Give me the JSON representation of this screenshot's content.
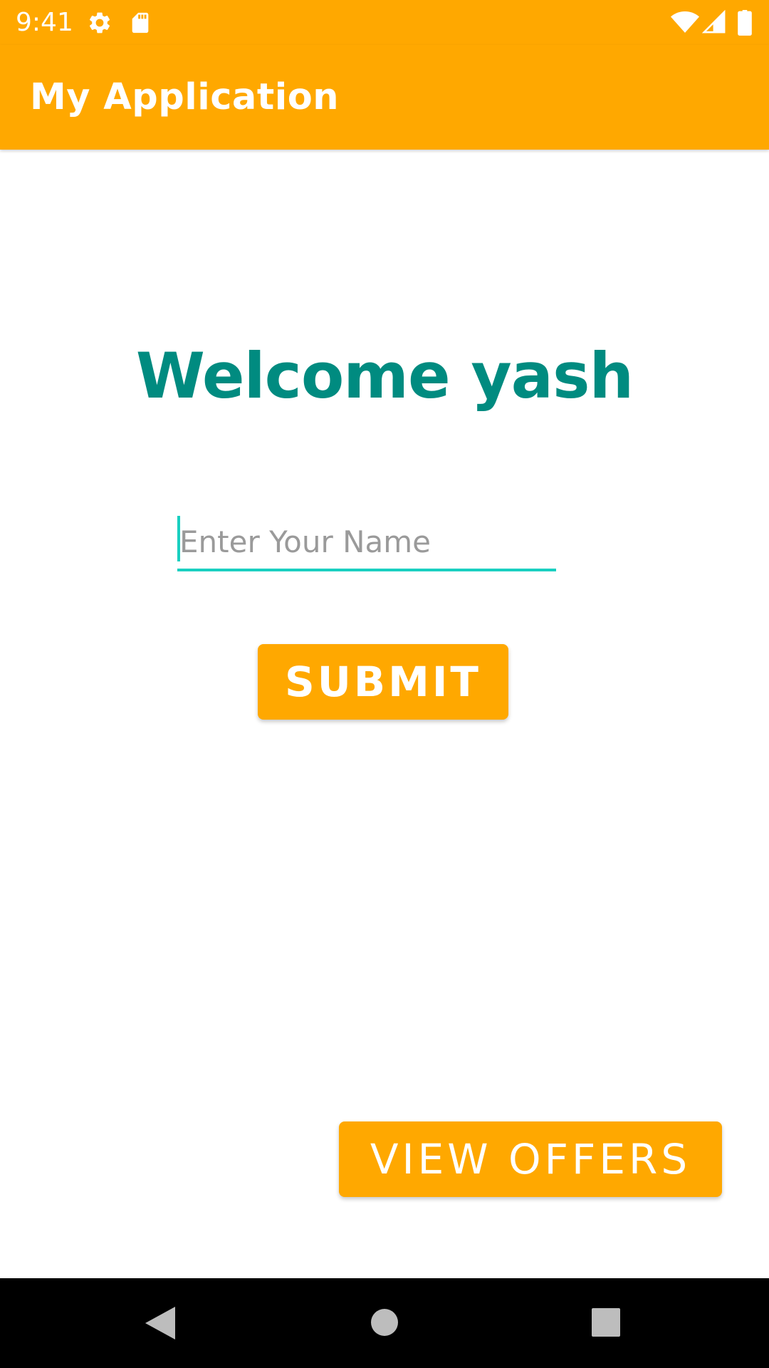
{
  "status_bar": {
    "time": "9:41",
    "icons": [
      "gear-icon",
      "sd-card-icon",
      "wifi-icon",
      "signal-icon",
      "battery-icon"
    ],
    "color": "#FFA800"
  },
  "app_bar": {
    "title": "My Application",
    "color": "#FFA800"
  },
  "main": {
    "welcome_text": "Welcome yash",
    "welcome_color": "#008B80",
    "name_input": {
      "value": "",
      "placeholder": "Enter Your Name",
      "accent_color": "#19CFC0"
    },
    "submit_label": "SUBMIT",
    "view_offers_label": "VIEW OFFERS"
  },
  "nav_bar": {
    "icons": [
      "back-icon",
      "home-icon",
      "recents-icon"
    ]
  }
}
